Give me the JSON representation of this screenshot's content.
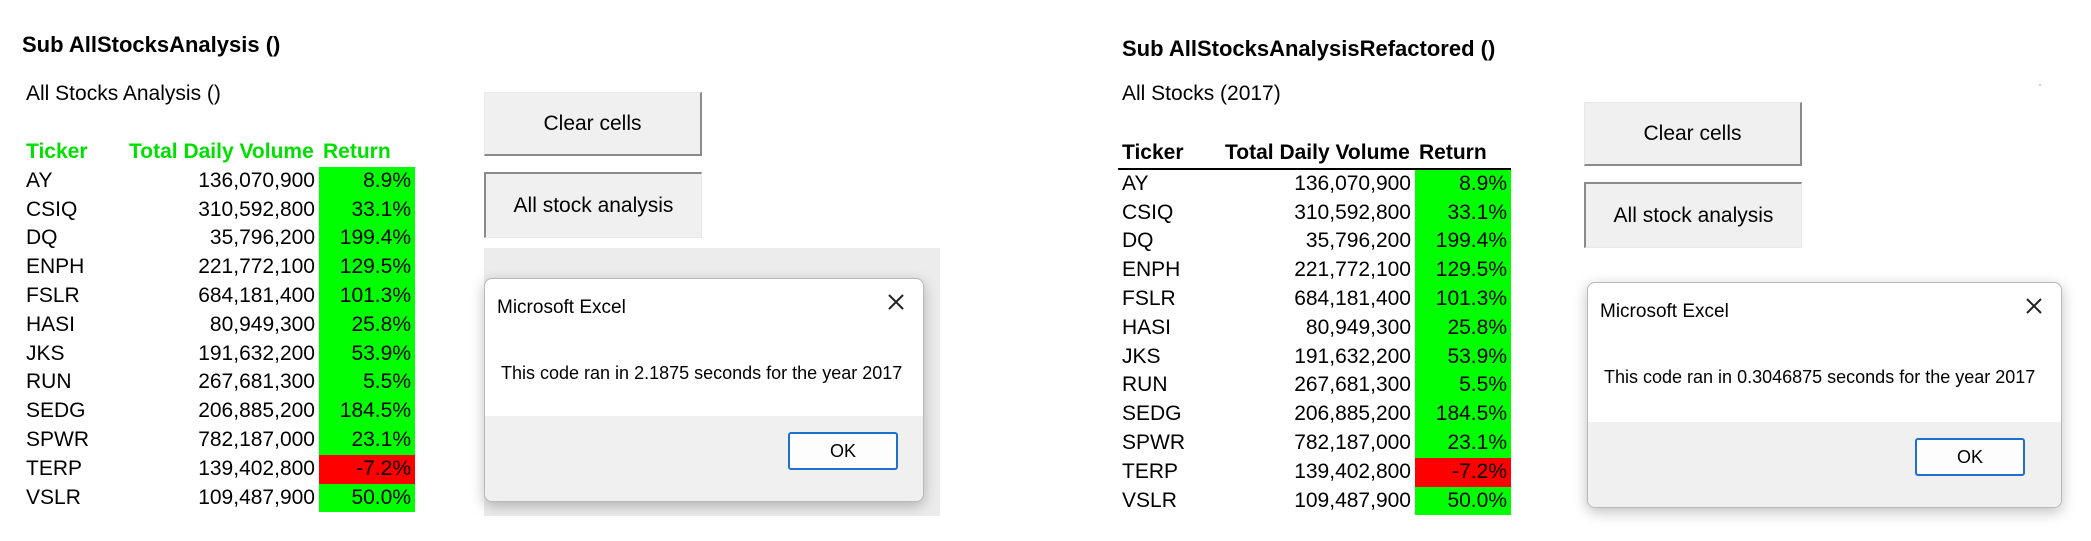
{
  "left": {
    "heading": "Sub AllStocksAnalysis ()",
    "subtitle": "All Stocks Analysis ()",
    "headers": {
      "ticker": "Ticker",
      "volume": "Total Daily Volume",
      "return": "Return"
    },
    "buttons": {
      "clear": "Clear cells",
      "analysis": "All stock analysis"
    },
    "dialog": {
      "title": "Microsoft Excel",
      "message": "This code ran in 2.1875 seconds for the year 2017",
      "ok": "OK"
    }
  },
  "right": {
    "heading": "Sub AllStocksAnalysisRefactored ()",
    "subtitle": "All Stocks (2017)",
    "headers": {
      "ticker": "Ticker",
      "volume": "Total Daily Volume",
      "return": "Return"
    },
    "buttons": {
      "clear": "Clear cells",
      "analysis": "All stock analysis"
    },
    "dialog": {
      "title": "Microsoft Excel",
      "message": "This code ran in 0.3046875 seconds for the year 2017",
      "ok": "OK"
    }
  },
  "rows": [
    {
      "ticker": "AY",
      "volume": "136,070,900",
      "return": "8.9%",
      "status": "positive"
    },
    {
      "ticker": "CSIQ",
      "volume": "310,592,800",
      "return": "33.1%",
      "status": "positive"
    },
    {
      "ticker": "DQ",
      "volume": "35,796,200",
      "return": "199.4%",
      "status": "positive"
    },
    {
      "ticker": "ENPH",
      "volume": "221,772,100",
      "return": "129.5%",
      "status": "positive"
    },
    {
      "ticker": "FSLR",
      "volume": "684,181,400",
      "return": "101.3%",
      "status": "positive"
    },
    {
      "ticker": "HASI",
      "volume": "80,949,300",
      "return": "25.8%",
      "status": "positive"
    },
    {
      "ticker": "JKS",
      "volume": "191,632,200",
      "return": "53.9%",
      "status": "positive"
    },
    {
      "ticker": "RUN",
      "volume": "267,681,300",
      "return": "5.5%",
      "status": "positive"
    },
    {
      "ticker": "SEDG",
      "volume": "206,885,200",
      "return": "184.5%",
      "status": "positive"
    },
    {
      "ticker": "SPWR",
      "volume": "782,187,000",
      "return": "23.1%",
      "status": "positive"
    },
    {
      "ticker": "TERP",
      "volume": "139,402,800",
      "return": "-7.2%",
      "status": "negative"
    },
    {
      "ticker": "VSLR",
      "volume": "109,487,900",
      "return": "50.0%",
      "status": "positive"
    }
  ],
  "colors": {
    "positive_fill": "#00ff00",
    "negative_fill": "#ff0000",
    "left_header_text": "#00e000",
    "ok_border": "#1f6fd0"
  },
  "icons": {
    "dialog_close": "close-icon"
  }
}
